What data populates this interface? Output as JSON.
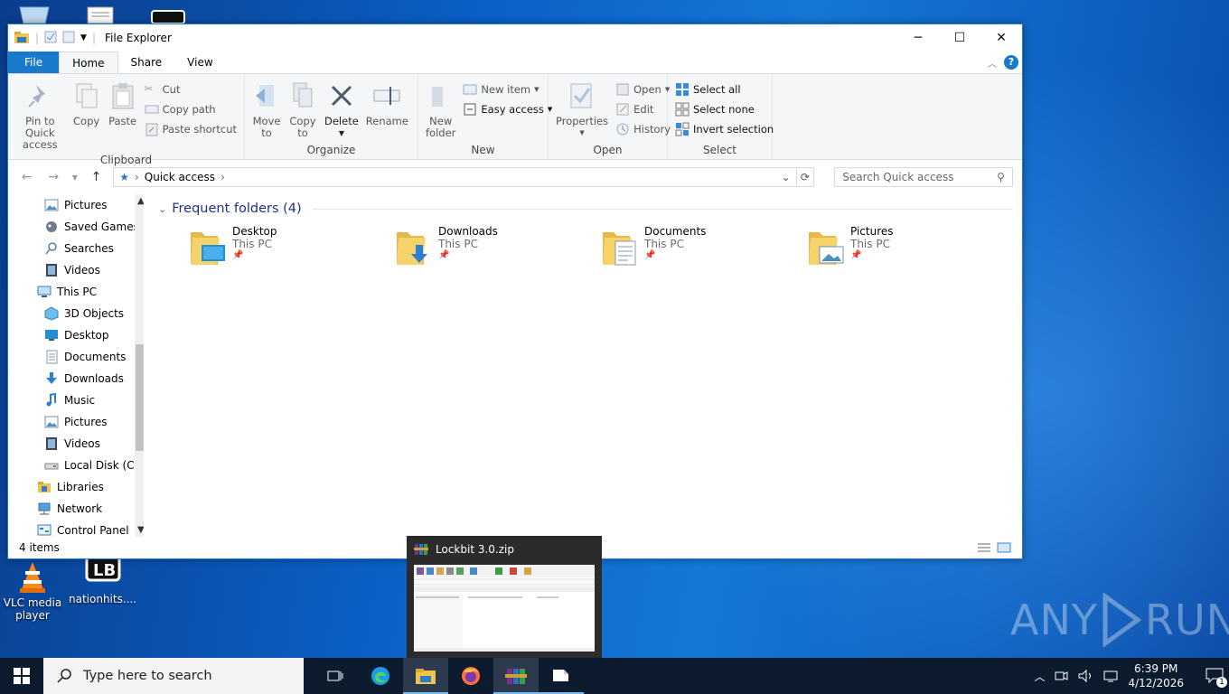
{
  "window": {
    "title": "File Explorer",
    "controls": {
      "minimize": "─",
      "maximize": "☐",
      "close": "✕"
    }
  },
  "tabs": {
    "file": "File",
    "home": "Home",
    "share": "Share",
    "view": "View"
  },
  "ribbon": {
    "clipboard": {
      "name": "Clipboard",
      "pin_line1": "Pin to Quick",
      "pin_line2": "access",
      "copy": "Copy",
      "paste": "Paste",
      "cut": "Cut",
      "copy_path": "Copy path",
      "paste_shortcut": "Paste shortcut"
    },
    "organize": {
      "name": "Organize",
      "move_line1": "Move",
      "move_line2": "to",
      "copy_line1": "Copy",
      "copy_line2": "to",
      "delete": "Delete",
      "rename": "Rename"
    },
    "new": {
      "name": "New",
      "new_folder_line1": "New",
      "new_folder_line2": "folder",
      "new_item": "New item",
      "easy_access": "Easy access"
    },
    "open": {
      "name": "Open",
      "properties": "Properties",
      "open": "Open",
      "edit": "Edit",
      "history": "History"
    },
    "select": {
      "name": "Select",
      "select_all": "Select all",
      "select_none": "Select none",
      "invert": "Invert selection"
    }
  },
  "address": {
    "location": "Quick access",
    "search_placeholder": "Search Quick access"
  },
  "nav_pane": [
    {
      "label": "Pictures",
      "icon": "pictures-icon",
      "indent": 1
    },
    {
      "label": "Saved Games",
      "icon": "saved-games-icon",
      "indent": 1
    },
    {
      "label": "Searches",
      "icon": "searches-icon",
      "indent": 1
    },
    {
      "label": "Videos",
      "icon": "videos-icon",
      "indent": 1
    },
    {
      "label": "This PC",
      "icon": "this-pc-icon",
      "indent": 0
    },
    {
      "label": "3D Objects",
      "icon": "3d-objects-icon",
      "indent": 1
    },
    {
      "label": "Desktop",
      "icon": "desktop-icon",
      "indent": 1
    },
    {
      "label": "Documents",
      "icon": "documents-icon",
      "indent": 1
    },
    {
      "label": "Downloads",
      "icon": "downloads-icon",
      "indent": 1
    },
    {
      "label": "Music",
      "icon": "music-icon",
      "indent": 1
    },
    {
      "label": "Pictures",
      "icon": "pictures-icon",
      "indent": 1
    },
    {
      "label": "Videos",
      "icon": "videos-icon",
      "indent": 1
    },
    {
      "label": "Local Disk (C:)",
      "icon": "local-disk-icon",
      "indent": 1
    },
    {
      "label": "Libraries",
      "icon": "libraries-icon",
      "indent": 0
    },
    {
      "label": "Network",
      "icon": "network-icon",
      "indent": 0
    },
    {
      "label": "Control Panel",
      "icon": "control-panel-icon",
      "indent": 0
    }
  ],
  "main": {
    "section_title": "Frequent folders (4)",
    "folders": [
      {
        "name": "Desktop",
        "location": "This PC"
      },
      {
        "name": "Downloads",
        "location": "This PC"
      },
      {
        "name": "Documents",
        "location": "This PC"
      },
      {
        "name": "Pictures",
        "location": "This PC"
      }
    ]
  },
  "status": {
    "items": "4 items"
  },
  "desktop": {
    "icons": [
      {
        "line1": "VLC media",
        "line2": "player"
      },
      {
        "line1": "nationhits....",
        "line2": ""
      }
    ],
    "watermark": "ANY RUN"
  },
  "thumbnail": {
    "title": "Lockbit 3.0.zip"
  },
  "taskbar": {
    "search_placeholder": "Type here to search",
    "time": "6:39 PM",
    "date": "4/12/2026",
    "notifications": "1"
  },
  "colors": {
    "accent": "#1979ca",
    "taskbar": "#0d1b2e",
    "section_title": "#1e3287"
  }
}
